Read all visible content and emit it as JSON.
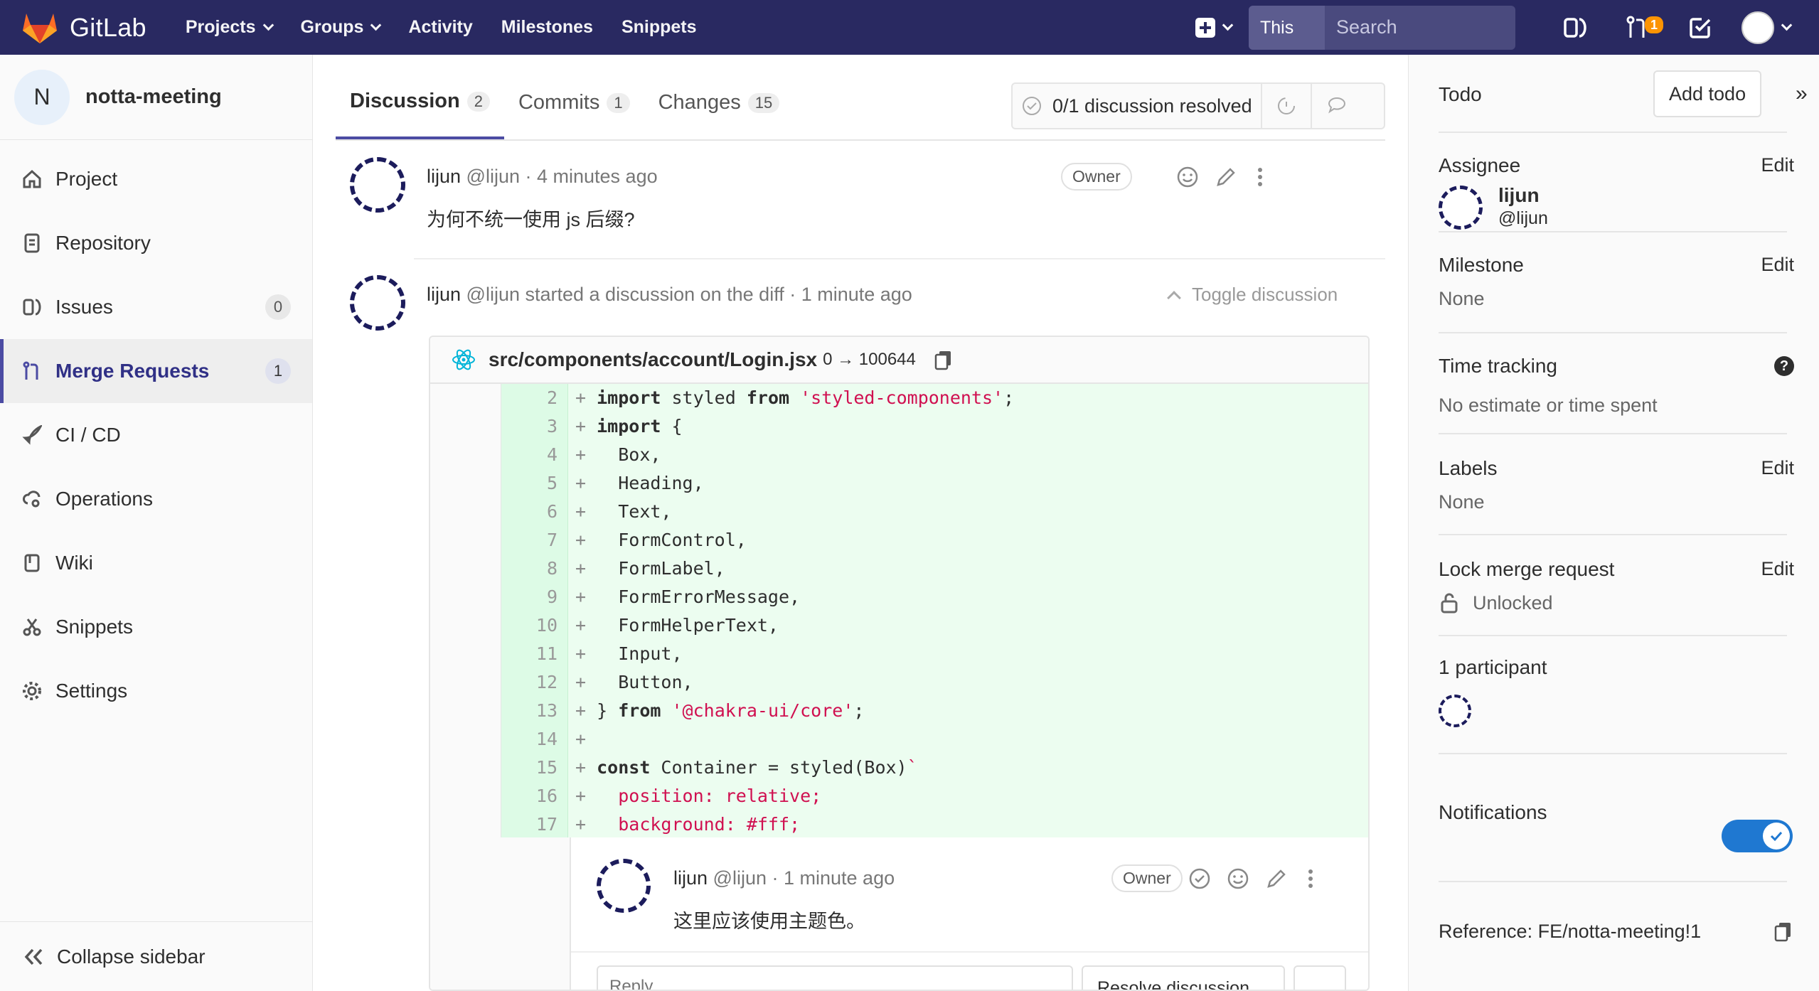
{
  "brand": {
    "name": "GitLab",
    "colors": {
      "nav": "#292961",
      "accent": "#4b4ba3",
      "added_bg": "#ecfdf0",
      "toggle": "#1f78d1",
      "badge": "#fc9403"
    }
  },
  "nav": {
    "links": [
      {
        "label": "Projects",
        "dropdown": true
      },
      {
        "label": "Groups",
        "dropdown": true
      },
      {
        "label": "Activity",
        "dropdown": false
      },
      {
        "label": "Milestones",
        "dropdown": false
      },
      {
        "label": "Snippets",
        "dropdown": false
      }
    ],
    "search_scope": "This project",
    "search_placeholder": "Search",
    "mr_count": "1"
  },
  "sidebar": {
    "project_initial": "N",
    "project_name": "notta-meeting",
    "items": [
      {
        "label": "Project",
        "icon": "home-icon"
      },
      {
        "label": "Repository",
        "icon": "doc-icon"
      },
      {
        "label": "Issues",
        "icon": "issues-icon",
        "count": "0"
      },
      {
        "label": "Merge Requests",
        "icon": "merge-request-icon",
        "count": "1",
        "active": true
      },
      {
        "label": "CI / CD",
        "icon": "rocket-icon"
      },
      {
        "label": "Operations",
        "icon": "cloud-gear-icon"
      },
      {
        "label": "Wiki",
        "icon": "book-icon"
      },
      {
        "label": "Snippets",
        "icon": "scissors-icon"
      },
      {
        "label": "Settings",
        "icon": "gear-icon"
      }
    ],
    "collapse_label": "Collapse sidebar"
  },
  "tabs": [
    {
      "label": "Discussion",
      "count": "2"
    },
    {
      "label": "Commits",
      "count": "1"
    },
    {
      "label": "Changes",
      "count": "15"
    }
  ],
  "resolve_status": "0/1 discussion resolved",
  "note1": {
    "author": "lijun",
    "handle": "@lijun",
    "time": "· 4 minutes ago",
    "badge": "Owner",
    "body": "为何不统一使用 js 后缀?"
  },
  "discussion": {
    "author": "lijun",
    "header_rest": "@lijun started a discussion on the diff · 1 minute ago",
    "toggle_label": "Toggle discussion",
    "file_name": "src/components/account/Login.jsx",
    "file_mode": "0 → 100644",
    "diff": [
      {
        "n": "2",
        "code": [
          "kw:import",
          " styled ",
          "kw:from",
          " ",
          "str:'styled-components'",
          ";"
        ]
      },
      {
        "n": "3",
        "code": [
          "kw:import",
          " {"
        ]
      },
      {
        "n": "4",
        "code": [
          "  Box,"
        ]
      },
      {
        "n": "5",
        "code": [
          "  Heading,"
        ]
      },
      {
        "n": "6",
        "code": [
          "  Text,"
        ]
      },
      {
        "n": "7",
        "code": [
          "  FormControl,"
        ]
      },
      {
        "n": "8",
        "code": [
          "  FormLabel,"
        ]
      },
      {
        "n": "9",
        "code": [
          "  FormErrorMessage,"
        ]
      },
      {
        "n": "10",
        "code": [
          "  FormHelperText,"
        ]
      },
      {
        "n": "11",
        "code": [
          "  Input,"
        ]
      },
      {
        "n": "12",
        "code": [
          "  Button,"
        ]
      },
      {
        "n": "13",
        "code": [
          "} ",
          "kw:from",
          " ",
          "str:'@chakra-ui/core'",
          ";"
        ]
      },
      {
        "n": "14",
        "code": [
          ""
        ]
      },
      {
        "n": "15",
        "code": [
          "kw:const",
          " Container = styled(Box)",
          "str:`"
        ]
      },
      {
        "n": "16",
        "code": [
          "  ",
          "str:position: relative;"
        ]
      },
      {
        "n": "17",
        "code": [
          "  ",
          "str:background: #fff;"
        ]
      }
    ],
    "reply_note": {
      "author": "lijun",
      "handle": "@lijun",
      "time": "· 1 minute ago",
      "badge": "Owner",
      "body": "这里应该使用主题色。"
    },
    "reply_placeholder": "Reply...",
    "resolve_button": "Resolve discussion"
  },
  "right": {
    "todo_label": "Todo",
    "add_todo": "Add todo",
    "assignee": {
      "title": "Assignee",
      "edit": "Edit",
      "name": "lijun",
      "handle": "@lijun"
    },
    "milestone": {
      "title": "Milestone",
      "edit": "Edit",
      "value": "None"
    },
    "time_tracking": {
      "title": "Time tracking",
      "value": "No estimate or time spent"
    },
    "labels": {
      "title": "Labels",
      "edit": "Edit",
      "value": "None"
    },
    "lock": {
      "title": "Lock merge request",
      "edit": "Edit",
      "value": "Unlocked"
    },
    "participants": {
      "title": "1 participant"
    },
    "notifications": {
      "title": "Notifications",
      "enabled": true
    },
    "reference": "Reference: FE/notta-meeting!1"
  }
}
